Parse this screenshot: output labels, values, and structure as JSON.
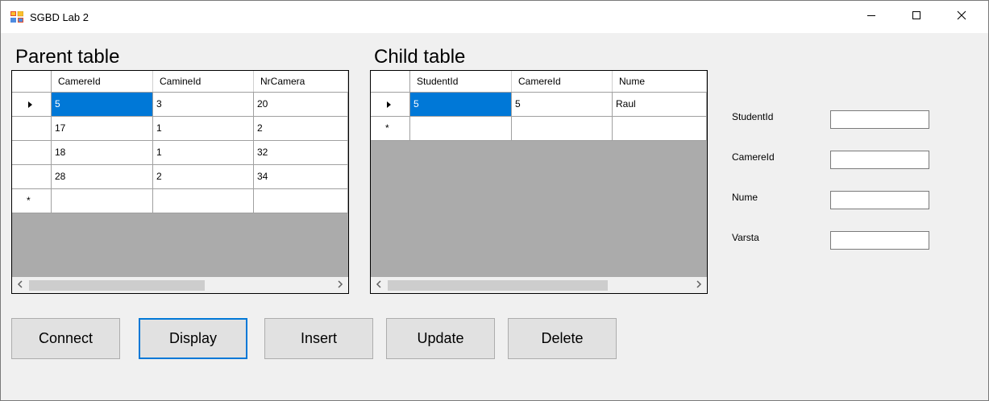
{
  "window": {
    "title": "SGBD Lab 2",
    "controls": {
      "minimize": "minimize",
      "maximize": "maximize",
      "close": "close"
    }
  },
  "parent": {
    "label": "Parent table",
    "columns": [
      "CamereId",
      "CamineId",
      "NrCamera"
    ],
    "rows": [
      [
        "5",
        "3",
        "20"
      ],
      [
        "17",
        "1",
        "2"
      ],
      [
        "18",
        "1",
        "32"
      ],
      [
        "28",
        "2",
        "34"
      ],
      [
        "",
        "",
        ""
      ]
    ],
    "selected_row": 0,
    "new_row_marker": "*",
    "scroll_fraction": 0.57
  },
  "child": {
    "label": "Child table",
    "columns": [
      "StudentId",
      "CamereId",
      "Nume"
    ],
    "rows": [
      [
        "5",
        "5",
        "Raul"
      ],
      [
        "",
        "",
        ""
      ]
    ],
    "selected_row": 0,
    "new_row_marker": "*",
    "scroll_fraction": 0.7
  },
  "form": {
    "fields": [
      {
        "label": "StudentId",
        "value": ""
      },
      {
        "label": "CamereId",
        "value": ""
      },
      {
        "label": "Nume",
        "value": ""
      },
      {
        "label": "Varsta",
        "value": ""
      }
    ]
  },
  "buttons": {
    "connect": "Connect",
    "display": "Display",
    "insert": "Insert",
    "update": "Update",
    "delete": "Delete"
  },
  "colors": {
    "selection": "#0078d7",
    "grid_background": "#ababab",
    "window_background": "#f0f0f0"
  },
  "icons": [
    "app-icon",
    "minimize-icon",
    "maximize-icon",
    "close-icon",
    "row-pointer-icon",
    "scroll-left-icon",
    "scroll-right-icon"
  ]
}
